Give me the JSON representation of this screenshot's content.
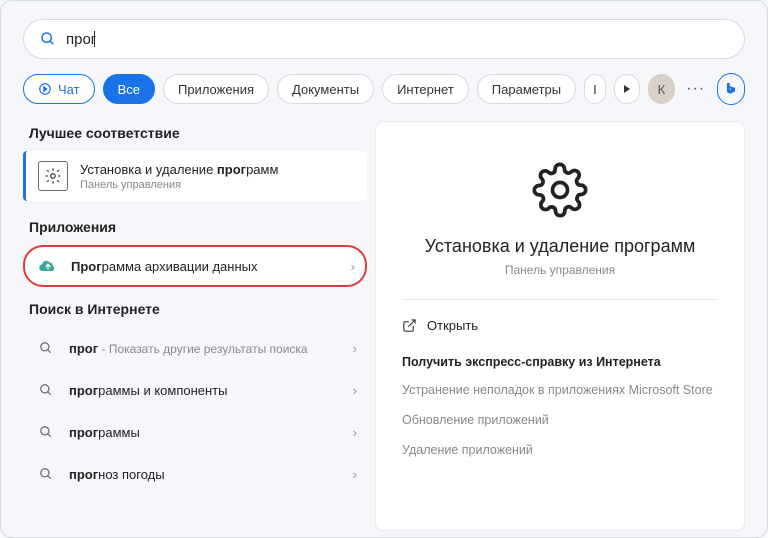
{
  "search": {
    "query": "прог"
  },
  "filters": {
    "chat": "Чат",
    "all": "Все",
    "apps": "Приложения",
    "documents": "Документы",
    "internet": "Интернет",
    "settings": "Параметры",
    "truncated": "І"
  },
  "avatar": {
    "initial": "К"
  },
  "left": {
    "best_match_header": "Лучшее соответствие",
    "best_match": {
      "title_prefix": "Установка и удаление ",
      "title_bold": "прог",
      "title_suffix": "рамм",
      "subtitle": "Панель управления"
    },
    "apps_header": "Приложения",
    "apps": [
      {
        "bold": "Прог",
        "rest": "рамма архивации данных"
      }
    ],
    "web_header": "Поиск в Интернете",
    "web": [
      {
        "bold": "прог",
        "rest": "",
        "sub": " - Показать другие результаты поиска"
      },
      {
        "bold": "прог",
        "rest": "раммы и компоненты",
        "sub": ""
      },
      {
        "bold": "прог",
        "rest": "раммы",
        "sub": ""
      },
      {
        "bold": "прог",
        "rest": "ноз погоды",
        "sub": ""
      }
    ]
  },
  "right": {
    "title": "Установка и удаление программ",
    "subtitle": "Панель управления",
    "open": "Открыть",
    "help_header": "Получить экспресс-справку из Интернета",
    "help_links": [
      "Устранение неполадок в приложениях Microsoft Store",
      "Обновление приложений",
      "Удаление приложений"
    ]
  }
}
